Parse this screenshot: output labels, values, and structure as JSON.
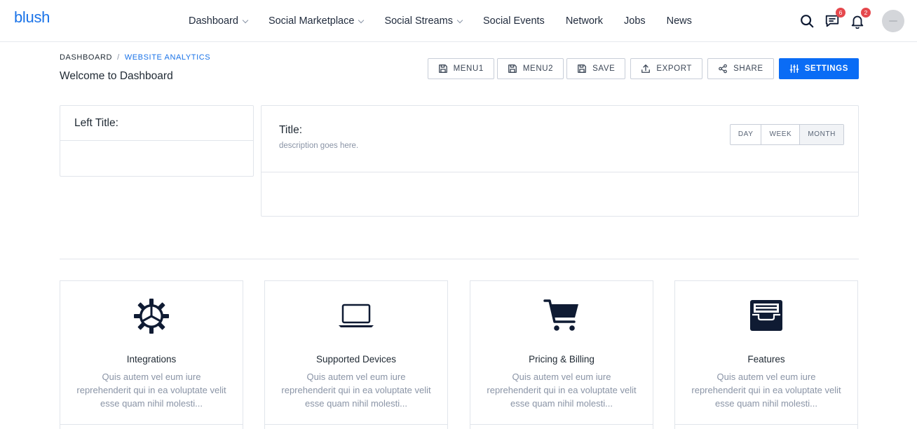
{
  "app": {
    "logo": "blush"
  },
  "nav": {
    "items": [
      {
        "label": "Dashboard",
        "dropdown": true
      },
      {
        "label": "Social Marketplace",
        "dropdown": true
      },
      {
        "label": "Social Streams",
        "dropdown": true
      },
      {
        "label": "Social Events",
        "dropdown": false
      },
      {
        "label": "Network",
        "dropdown": false
      },
      {
        "label": "Jobs",
        "dropdown": false
      },
      {
        "label": "News",
        "dropdown": false
      }
    ]
  },
  "header_icons": {
    "messages_count": "6",
    "notifications_count": "2"
  },
  "breadcrumb": {
    "home": "DASHBOARD",
    "separator": "/",
    "current": "WEBSITE ANALYTICS"
  },
  "page": {
    "title": "Welcome to Dashboard"
  },
  "actions": {
    "menu1": "MENU1",
    "menu2": "MENU2",
    "save": "SAVE",
    "export": "EXPORT",
    "share": "SHARE",
    "settings": "SETTINGS"
  },
  "left_card": {
    "title": "Left Title:"
  },
  "main_card": {
    "title": "Title:",
    "description": "description goes here.",
    "range": {
      "day": "DAY",
      "week": "WEEK",
      "month": "MONTH",
      "selected": "MONTH"
    }
  },
  "features": [
    {
      "icon": "gear-icon",
      "title": "Integrations",
      "text": "Quis autem vel eum iure reprehenderit qui in ea voluptate velit esse quam nihil molesti..."
    },
    {
      "icon": "laptop-icon",
      "title": "Supported Devices",
      "text": "Quis autem vel eum iure reprehenderit qui in ea voluptate velit esse quam nihil molesti..."
    },
    {
      "icon": "cart-icon",
      "title": "Pricing & Billing",
      "text": "Quis autem vel eum iure reprehenderit qui in ea voluptate velit esse quam nihil molesti..."
    },
    {
      "icon": "inbox-tray-icon",
      "title": "Features",
      "text": "Quis autem vel eum iure reprehenderit qui in ea voluptate velit esse quam nihil molesti..."
    }
  ],
  "colors": {
    "brand": "#1a73e8",
    "primary_button": "#0a6cf5",
    "badge": "#e5484d",
    "icon_dark": "#0f1b33"
  }
}
